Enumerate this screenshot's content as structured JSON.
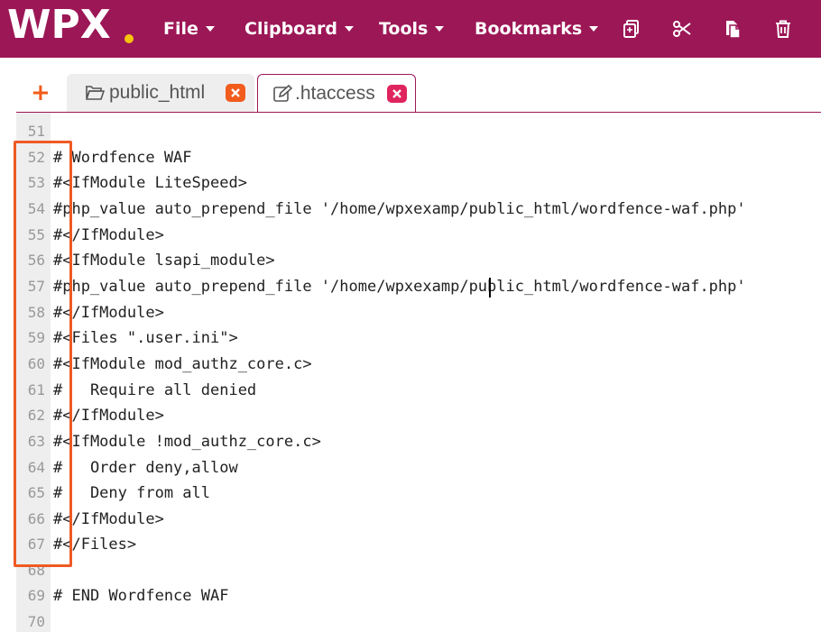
{
  "app": {
    "logo_text": "WPX",
    "menu": [
      {
        "label": "File"
      },
      {
        "label": "Clipboard"
      },
      {
        "label": "Tools"
      },
      {
        "label": "Bookmarks"
      }
    ],
    "toolbar_icons": [
      "copy-icon",
      "scissors-icon",
      "paste-icon",
      "trash-icon"
    ],
    "colors": {
      "brand": "#9c1756",
      "logo_dot": "#f6c40e",
      "accent": "#f25c1d",
      "close_active": "#e0245e",
      "highlight": "#ee5a24"
    }
  },
  "tabs": {
    "add_symbol": "+",
    "items": [
      {
        "label": "public_html",
        "icon": "folder-open-icon",
        "active": false
      },
      {
        "label": ".htaccess",
        "icon": "edit-file-icon",
        "active": true
      }
    ]
  },
  "editor": {
    "lines": [
      {
        "n": "51",
        "text": ""
      },
      {
        "n": "52",
        "text": "# Wordfence WAF"
      },
      {
        "n": "53",
        "text": "#<IfModule LiteSpeed>"
      },
      {
        "n": "54",
        "text": "#php_value auto_prepend_file '/home/wpxexamp/public_html/wordfence-waf.php'"
      },
      {
        "n": "55",
        "text": "#</IfModule>"
      },
      {
        "n": "56",
        "text": "#<IfModule lsapi_module>"
      },
      {
        "n": "57",
        "text": "#php_value auto_prepend_file '/home/wpxexamp/public_html/wordfence-waf.php'"
      },
      {
        "n": "58",
        "text": "#</IfModule>"
      },
      {
        "n": "59",
        "text": "#<Files \".user.ini\">"
      },
      {
        "n": "60",
        "text": "#<IfModule mod_authz_core.c>"
      },
      {
        "n": "61",
        "text": "#   Require all denied"
      },
      {
        "n": "62",
        "text": "#</IfModule>"
      },
      {
        "n": "63",
        "text": "#<IfModule !mod_authz_core.c>"
      },
      {
        "n": "64",
        "text": "#   Order deny,allow"
      },
      {
        "n": "65",
        "text": "#   Deny from all"
      },
      {
        "n": "66",
        "text": "#</IfModule>"
      },
      {
        "n": "67",
        "text": "#</Files>"
      },
      {
        "n": "68",
        "text": ""
      },
      {
        "n": "69",
        "text": "# END Wordfence WAF"
      },
      {
        "n": "70",
        "text": ""
      }
    ]
  }
}
